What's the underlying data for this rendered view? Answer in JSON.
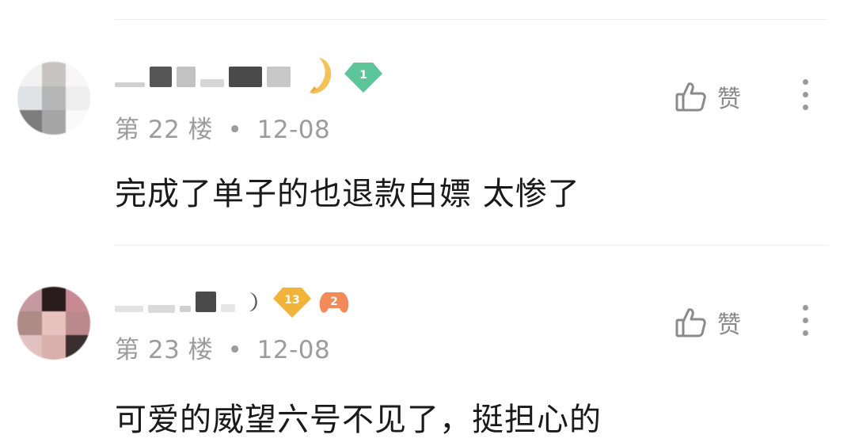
{
  "comments": [
    {
      "floor_label": "第 22 楼",
      "separator": "•",
      "date": "12-08",
      "text": "完成了单子的也退款白嫖 太惨了",
      "level_badge": "1",
      "badge_color": "#5cc59a",
      "like_label": "赞",
      "like_icon": "thumbs-up-icon",
      "more_icon": "more-vertical-icon"
    },
    {
      "floor_label": "第 23 楼",
      "separator": "•",
      "date": "12-08",
      "text": "可爱的威望六号不见了，挺担心的",
      "level_badge": "13",
      "badge_color": "#f2b33a",
      "extra_badge": "2",
      "like_label": "赞",
      "like_icon": "thumbs-up-icon",
      "more_icon": "more-vertical-icon"
    }
  ]
}
